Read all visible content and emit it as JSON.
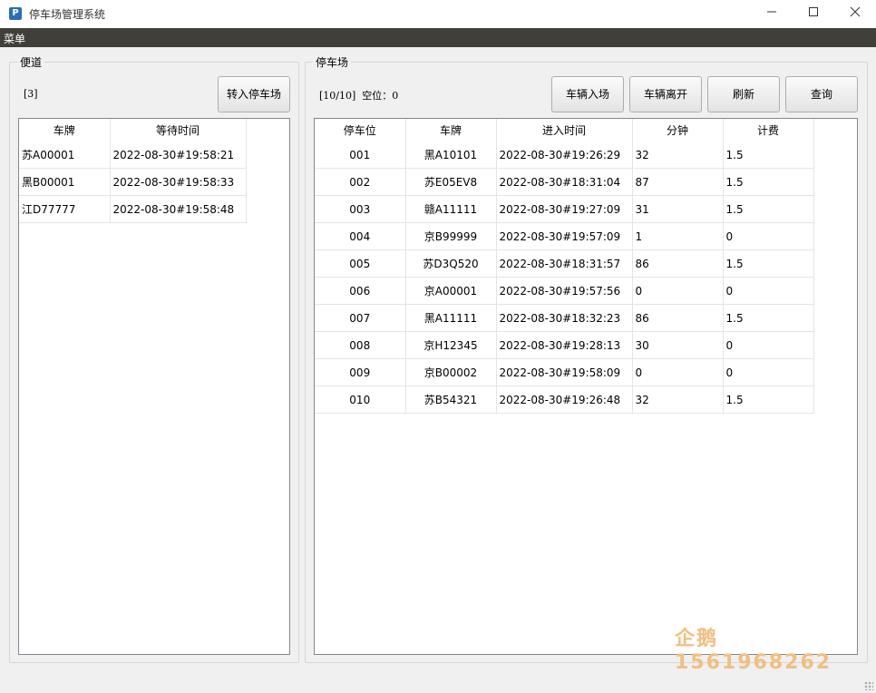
{
  "window": {
    "title": "停车场管理系统",
    "icon": "P"
  },
  "menubar": {
    "items": [
      "菜单"
    ]
  },
  "sidebar": {
    "group_title": "便道",
    "count_label": "[3]",
    "transfer_button": "转入停车场",
    "columns": [
      "车牌",
      "等待时间"
    ],
    "rows": [
      [
        "苏A00001",
        "2022-08-30#19:58:21"
      ],
      [
        "黑B00001",
        "2022-08-30#19:58:33"
      ],
      [
        "江D77777",
        "2022-08-30#19:58:48"
      ]
    ]
  },
  "parking": {
    "group_title": "停车场",
    "status_label": "[10/10]  空位：0",
    "buttons": {
      "enter": "车辆入场",
      "leave": "车辆离开",
      "refresh": "刷新",
      "query": "查询"
    },
    "columns": [
      "停车位",
      "车牌",
      "进入时间",
      "分钟",
      "计费"
    ],
    "rows": [
      [
        "001",
        "黑A10101",
        "2022-08-30#19:26:29",
        "32",
        "1.5"
      ],
      [
        "002",
        "苏E05EV8",
        "2022-08-30#18:31:04",
        "87",
        "1.5"
      ],
      [
        "003",
        "赣A11111",
        "2022-08-30#19:27:09",
        "31",
        "1.5"
      ],
      [
        "004",
        "京B99999",
        "2022-08-30#19:57:09",
        "1",
        "0"
      ],
      [
        "005",
        "苏D3Q520",
        "2022-08-30#18:31:57",
        "86",
        "1.5"
      ],
      [
        "006",
        "京A00001",
        "2022-08-30#19:57:56",
        "0",
        "0"
      ],
      [
        "007",
        "黑A11111",
        "2022-08-30#18:32:23",
        "86",
        "1.5"
      ],
      [
        "008",
        "京H12345",
        "2022-08-30#19:28:13",
        "30",
        "0"
      ],
      [
        "009",
        "京B00002",
        "2022-08-30#19:58:09",
        "0",
        "0"
      ],
      [
        "010",
        "苏B54321",
        "2022-08-30#19:26:48",
        "32",
        "1.5"
      ]
    ]
  },
  "watermark": "企鹅 1561968262",
  "icons": {
    "minimize": "minimize-icon",
    "maximize": "maximize-icon",
    "close": "close-icon"
  }
}
